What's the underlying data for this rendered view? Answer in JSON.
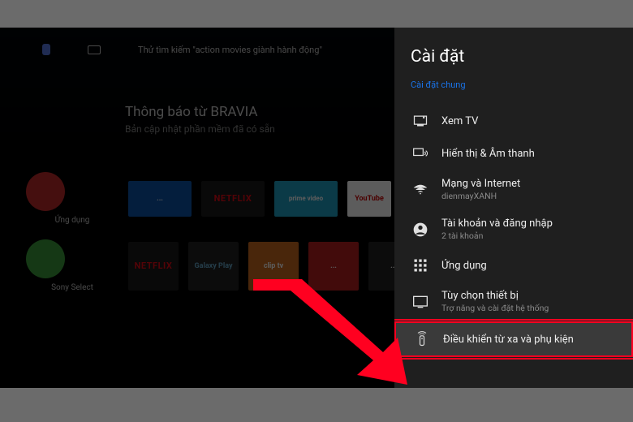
{
  "home": {
    "search_hint": "Thử tìm kiếm \"action movies giành hành động\"",
    "notice_title": "Thông báo từ BRAVIA",
    "notice_sub": "Bản cập nhật phần mềm đã có sẵn",
    "bubble1_label": "Ứng dụng",
    "bubble2_label": "Sony Select",
    "tiles_row1": {
      "t0": "...",
      "t1": "NETFLIX",
      "t2": "prime video",
      "t3": "YouTube"
    },
    "tiles_row2": {
      "t0": "NETFLIX",
      "t1": "Galaxy Play",
      "t2": "clip tv",
      "t3": "...",
      "t4": "..."
    }
  },
  "settings": {
    "title": "Cài đặt",
    "category": "Cài đặt chung",
    "items": [
      {
        "label": "Xem TV",
        "sub": ""
      },
      {
        "label": "Hiển thị & Âm thanh",
        "sub": ""
      },
      {
        "label": "Mạng và Internet",
        "sub": "dienmayXANH"
      },
      {
        "label": "Tài khoản và đăng nhập",
        "sub": "2 tài khoản"
      },
      {
        "label": "Ứng dụng",
        "sub": ""
      },
      {
        "label": "Tùy chọn thiết bị",
        "sub": "Trợ năng và cài đặt hệ thống"
      },
      {
        "label": "Điều khiển từ xa và phụ kiện",
        "sub": ""
      }
    ]
  }
}
